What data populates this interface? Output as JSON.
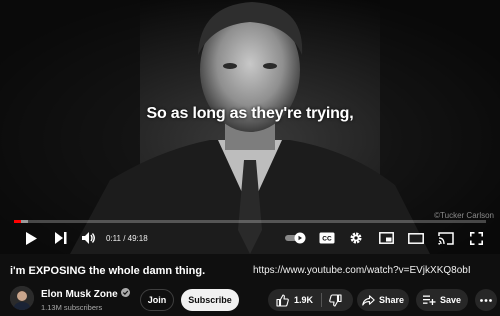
{
  "player": {
    "caption": "So as long as they're trying,",
    "watermark": "©Tucker Carlson",
    "current_time": "0:11",
    "time_separator": " / ",
    "duration": "49:18",
    "progress_fraction": 0.0037,
    "buffer_fraction": 0.03,
    "controls": {
      "play": "play-icon",
      "next": "next-icon",
      "volume": "volume-icon",
      "autoplay": "autoplay-toggle-icon",
      "captions": "CC",
      "settings": "gear-icon",
      "miniplayer": "miniplayer-icon",
      "theater": "theater-icon",
      "cast": "cast-icon",
      "fullscreen": "fullscreen-icon"
    }
  },
  "video": {
    "title": "i'm EXPOSING the whole damn thing.",
    "url": "https://www.youtube.com/watch?v=EVjkXKQ8obI"
  },
  "channel": {
    "name": "Elon Musk Zone",
    "verified_icon": "verified-check-icon",
    "subscribers": "1.13M subscribers"
  },
  "actions": {
    "join_label": "Join",
    "subscribe_label": "Subscribe",
    "like_count": "1.9K",
    "share_label": "Share",
    "save_label": "Save"
  },
  "colors": {
    "accent": "#ff0000",
    "background": "#0f0f0f",
    "button_bg": "#272727",
    "subscribe_bg": "#f1f1f1"
  }
}
